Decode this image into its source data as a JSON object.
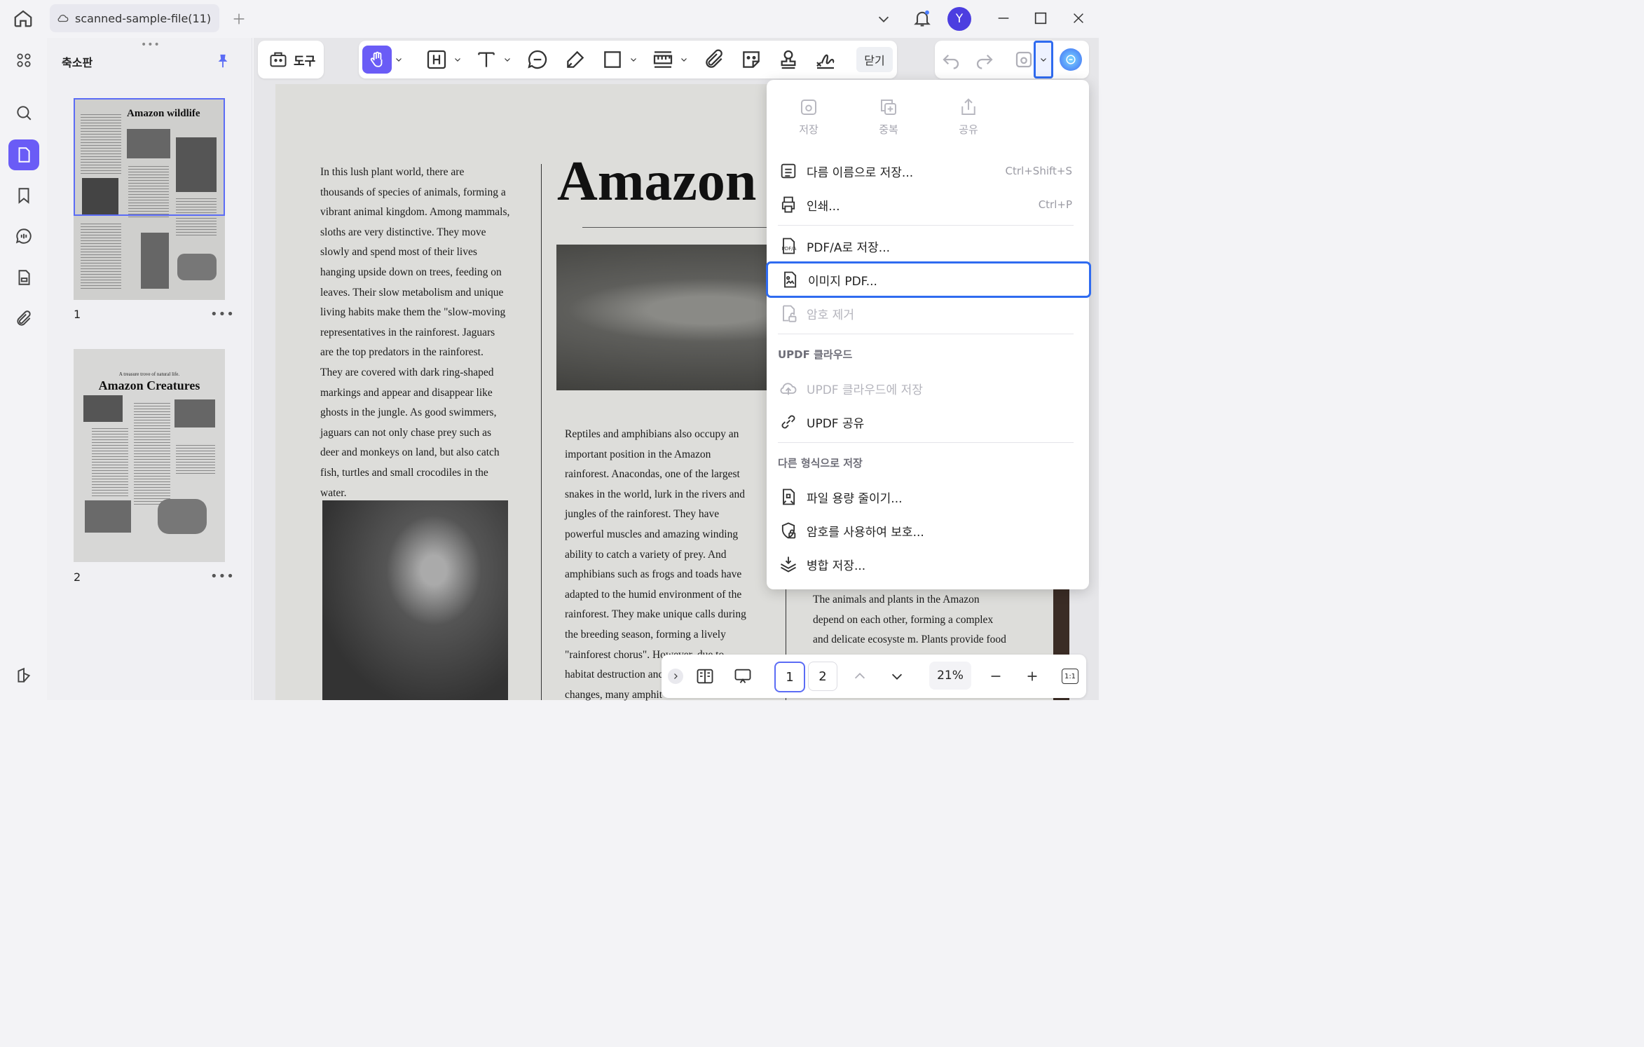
{
  "window": {
    "tab_title": "scanned-sample-file(11)",
    "avatar_letter": "Y"
  },
  "thumbnail_panel": {
    "title": "축소판",
    "pages": [
      {
        "number": "1",
        "heading": "Amazon wildlife"
      },
      {
        "number": "2",
        "kicker": "A treasure trove of natural life.",
        "heading": "Amazon Creatures"
      }
    ]
  },
  "toolbar": {
    "tools_label": "도구",
    "close_label": "닫기"
  },
  "document": {
    "title": "Amazon",
    "col1": "In this lush plant world, there are\nthousands of species of animals, forming a\nvibrant animal kingdom. Among mammals,\nsloths are very distinctive. They move\nslowly and spend most of their lives\nhanging upside down on trees, feeding on\nleaves. Their slow metabolism and unique\nliving habits make them the \"slow-moving\nrepresentatives in the rainforest. Jaguars\nare the top predators in the rainforest.\nThey are covered with dark ring-shaped\nmarkings and appear and disappear like\nghosts in the jungle. As good swimmers,\njaguars can not only chase prey such as\ndeer and monkeys on land, but also catch\nfish, turtles and small crocodiles in the\nwater.",
    "col2": "Reptiles and amphibians also occupy an\nimportant position in the Amazon\nrainforest. Anacondas, one of the largest\nsnakes in the world, lurk in the rivers and\njungles of the rainforest. They have\npowerful muscles and amazing winding\nability to catch a variety of prey. And\namphibians such as frogs and toads have\nadapted to the humid environment of the\nrainforest. They make unique calls during\nthe breeding season, forming a lively\n\"rainforest chorus\". However, due to\nhabitat destruction anc\nchanges, many amphit",
    "col3": "The animals and plants in the Amazon\ndepend on each other, forming a complex\nand delicate ecosyste  m. Plants provide food"
  },
  "menu": {
    "quick_actions": [
      {
        "label": "저장",
        "icon": "save-icon"
      },
      {
        "label": "중복",
        "icon": "duplicate-icon"
      },
      {
        "label": "공유",
        "icon": "share-icon"
      }
    ],
    "save_as": {
      "label": "다름 이름으로 저장...",
      "shortcut": "Ctrl+Shift+S"
    },
    "print": {
      "label": "인쇄...",
      "shortcut": "Ctrl+P"
    },
    "pdfa": {
      "label": "PDF/A로 저장..."
    },
    "image_pdf": {
      "label": "이미지 PDF..."
    },
    "remove_password": {
      "label": "암호 제거"
    },
    "cloud_section": "UPDF 클라우드",
    "cloud_save": {
      "label": "UPDF 클라우드에 저장"
    },
    "updf_share": {
      "label": "UPDF 공유"
    },
    "other_section": "다른 형식으로 저장",
    "reduce_size": {
      "label": "파일 용량 줄이기..."
    },
    "protect_password": {
      "label": "암호를 사용하여 보호..."
    },
    "merge_save": {
      "label": "병합 저장..."
    }
  },
  "bottom_bar": {
    "page_current": "1",
    "page_total": "2",
    "zoom": "21%",
    "fit_label": "1:1"
  },
  "colors": {
    "accent": "#6a5cf6",
    "highlight": "#2f6bf0"
  }
}
